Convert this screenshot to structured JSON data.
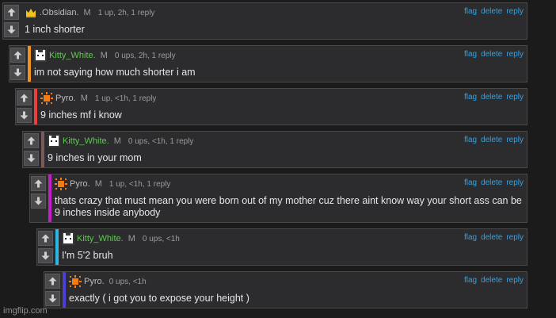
{
  "comments": [
    {
      "username": ".Obsidian.",
      "username_color": "#bdbdbd",
      "avatar_icon": "crown-icon",
      "bar_color": "#2c2c2e",
      "mod_tag": "M",
      "stats": "1 up, 2h, 1 reply",
      "text": "1 inch shorter",
      "actions": [
        "flag",
        "delete",
        "reply"
      ]
    },
    {
      "username": "Kitty_White.",
      "username_color": "#5ec94f",
      "avatar_icon": "pixel-cat-icon",
      "bar_color": "#f0931e",
      "mod_tag": "M",
      "stats": "0 ups, 2h, 1 reply",
      "text": "im not saying how much shorter i am",
      "actions": [
        "flag",
        "delete",
        "reply"
      ]
    },
    {
      "username": "Pyro.",
      "username_color": "#bdbdbd",
      "avatar_icon": "pixel-sun-icon",
      "bar_color": "#e8403a",
      "mod_tag": "M",
      "stats": "1 up, <1h, 1 reply",
      "text": "9 inches mf i know",
      "actions": [
        "flag",
        "delete",
        "reply"
      ]
    },
    {
      "username": "Kitty_White.",
      "username_color": "#5ec94f",
      "avatar_icon": "pixel-cat-icon",
      "bar_color": "#7a5a5a",
      "mod_tag": "M",
      "stats": "0 ups, <1h, 1 reply",
      "text": "9 inches in your mom",
      "actions": [
        "flag",
        "delete",
        "reply"
      ]
    },
    {
      "username": "Pyro.",
      "username_color": "#bdbdbd",
      "avatar_icon": "pixel-sun-icon",
      "bar_color": "#c21fc6",
      "mod_tag": "M",
      "stats": "1 up, <1h, 1 reply",
      "text": "thats crazy that must mean you were born out of my mother cuz there aint know way your short ass can be 9 inches inside anybody",
      "actions": [
        "flag",
        "delete",
        "reply"
      ]
    },
    {
      "username": "Kitty_White.",
      "username_color": "#5ec94f",
      "avatar_icon": "pixel-cat-icon",
      "bar_color": "#29b8e6",
      "mod_tag": "M",
      "stats": "0 ups, <1h",
      "text": "I'm 5'2 bruh",
      "actions": [
        "flag",
        "delete",
        "reply"
      ]
    },
    {
      "username": "Pyro.",
      "username_color": "#bdbdbd",
      "avatar_icon": "pixel-sun-icon",
      "bar_color": "#4b3fd6",
      "mod_tag": "",
      "stats": "0 ups, <1h",
      "text": "exactly ( i got you to expose your height )",
      "actions": [
        "flag",
        "delete",
        "reply"
      ]
    }
  ],
  "watermark": "imgflip.com"
}
